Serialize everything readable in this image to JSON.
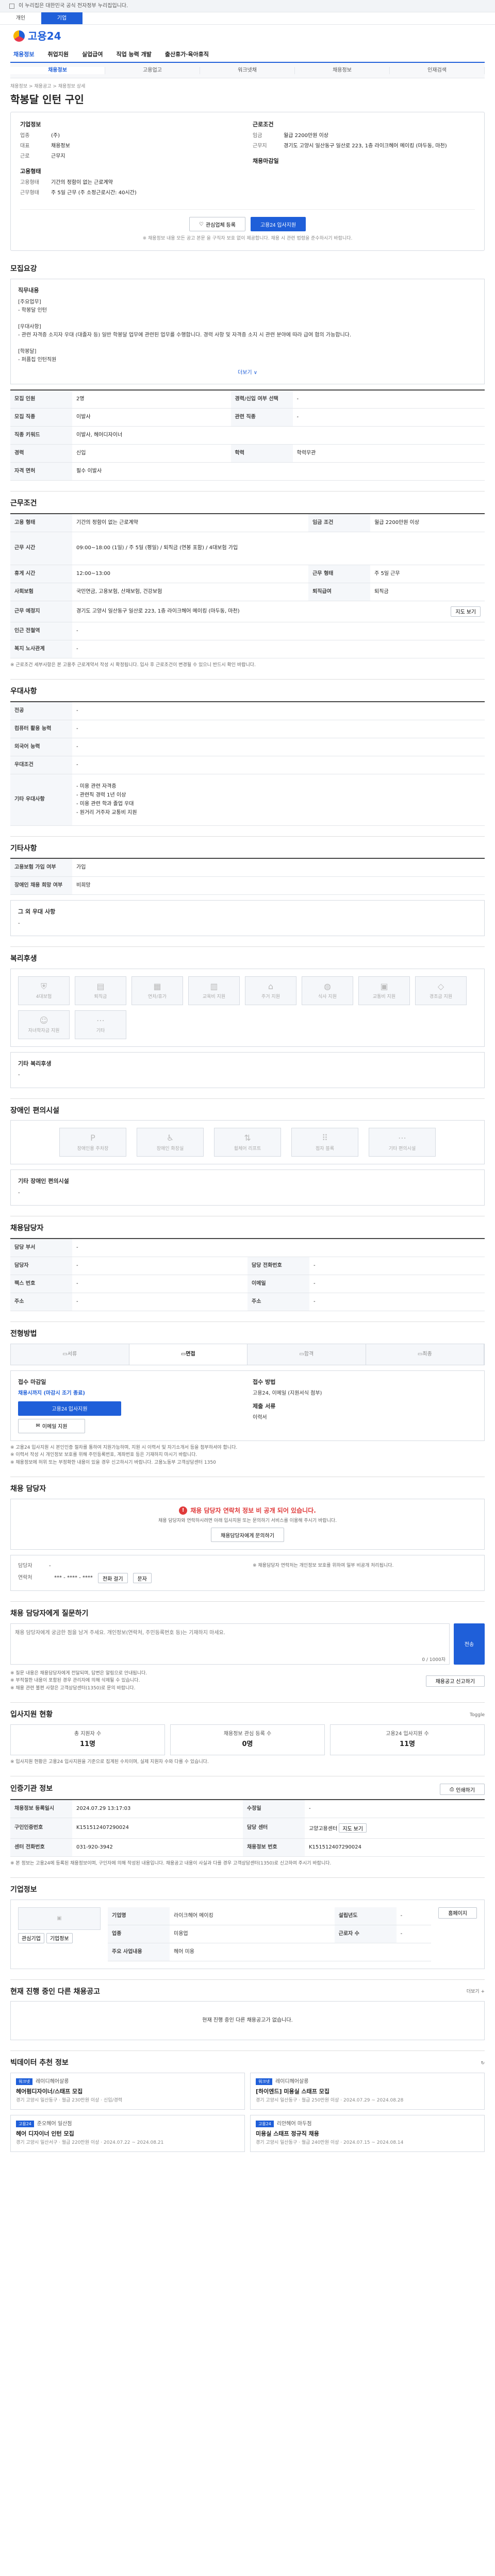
{
  "topbar": {
    "notice": "이 누리집은 대한민국 공식 전자정부 누리집입니다."
  },
  "site_switch": [
    {
      "label": "개인",
      "on": false
    },
    {
      "label": "기업",
      "on": true
    }
  ],
  "logo": {
    "text": "고용24"
  },
  "gnb": [
    {
      "label": "채용정보",
      "on": true
    },
    {
      "label": "취업지원"
    },
    {
      "label": "실업급여"
    },
    {
      "label": "직업 능력 개발"
    },
    {
      "label": "출산휴가·육아휴직"
    }
  ],
  "subnav": [
    "채용정보",
    "고용업고",
    "워크넷채",
    "채용정보",
    "인재검색"
  ],
  "breadcrumb": "채용정보 > 채용공고 > 채용정보 상세",
  "job": {
    "title": "학봉달 인턴 구인",
    "company_section": "기업정보",
    "company_rows": [
      {
        "k": "업종",
        "v": "(주)"
      },
      {
        "k": "대표",
        "v": "채용정보"
      },
      {
        "k": "근로",
        "v": "근무지"
      }
    ],
    "cond_section": "근로조건",
    "cond_rows": [
      {
        "k": "임금",
        "v": "월급 2200만원 이상"
      },
      {
        "k": "근무지",
        "v": "경기도 고양시 일산동구 일산로 223, 1층 라이크헤어 메이킹 (마두동, 마천)"
      }
    ],
    "manager_section": "고용형태",
    "manager_rows": [
      {
        "k": "고용형태",
        "v": "기간의 정함이 없는 근로계약"
      },
      {
        "k": "근무형태",
        "v": "주 5일 근무 (주 소정근로시간: 40시간)"
      }
    ],
    "reception_section": "채용마감일",
    "save_label": "관심업체 등록",
    "apply_label": "고용24 입사지원",
    "note": "※ 채용정보 내용 모든 공고 본문 을 구직자 보호 없이 제공합니다. 채용 시 관련 법령을 준수하시기 바랍니다."
  },
  "recruit": {
    "title": "모집요강",
    "heading": "직무내용",
    "body": "[주요업무]\n- 학봉달 인턴\n\n[우대사항]\n- 관련 자격증 소지자 우대 (대졸자 등) 일반 학봉달 업무에 관련된 업무를 수행합니다. 경력 사항 및 자격증 소지 시 관련 분야에 따라 급여 협의 가능합니다.\n\n[학봉달]\n- 퍼퓸집 인턴직원",
    "more_label": "더보기 ∨",
    "rows": [
      {
        "k": "모집 인원",
        "v": "2명",
        "k2": "경력/신입 여부 선택",
        "v2": "-"
      },
      {
        "k": "모집 직종",
        "v": "이발사",
        "k2": "관련 직종",
        "v2": "-"
      },
      {
        "k": "직종 키워드",
        "v": "이발사, 헤어디자이너",
        "k2": "",
        "v2": ""
      },
      {
        "k": "경력",
        "v": "신입",
        "k2": "학력",
        "v2": "학력무관"
      },
      {
        "k": "자격 면허",
        "v": "필수 이발사",
        "k2": "",
        "v2": ""
      }
    ]
  },
  "work": {
    "title": "근무조건",
    "rows": [
      {
        "k": "고용 형태",
        "v": "기간의 정함이 없는 근로계약",
        "k2": "임금 조건",
        "v2": "월급 2200만원 이상"
      },
      {
        "k": "근무 시간",
        "v": "09:00~18:00 (1일) / 주 5일 (평일) / 퇴직금 (연봉 포함) / 4대보험 가입"
      },
      {
        "k": "휴게 시간",
        "v": "12:00~13:00",
        "k2": "근무 형태",
        "v2": "주 5일 근무"
      },
      {
        "k": "사회보험",
        "v": "국민연금, 고용보험, 산재보험, 건강보험",
        "k2": "퇴직급여",
        "v2": "퇴직금"
      },
      {
        "k": "근무 예정지",
        "v": "경기도 고양시 일산동구 일산로 223, 1층 라이크헤어 메이킹 (마두동, 마천)",
        "k2": "",
        "v2": ""
      },
      {
        "k": "인근 전철역",
        "v": "-",
        "k2": "",
        "v2": ""
      },
      {
        "k": "복지 노사관계",
        "v": "-",
        "k2": "",
        "v2": ""
      }
    ],
    "map_label": "지도 보기",
    "note": "※ 근로조건 세부사항은 본 고용주 근로계약서 작성 시 확정됩니다. 입사 후 근로조건이 변경될 수 있으니 반드시 확인 바랍니다."
  },
  "prefer": {
    "title": "우대사항",
    "rows": [
      {
        "k": "전공",
        "v": "-"
      },
      {
        "k": "컴퓨터 활용 능력",
        "v": "-"
      },
      {
        "k": "외국어 능력",
        "v": "-"
      },
      {
        "k": "우대조건",
        "v": "-"
      },
      {
        "k": "기타 우대사항",
        "v": "- 미용 관련 자격증\n- 관련직 경력 1년 이상\n- 미용 관련 학과 졸업 우대\n- 원거리 거주자 교통비 지원"
      }
    ]
  },
  "extra": {
    "title": "기타사항",
    "rows": [
      {
        "k": "고용보험 가입 여부",
        "v": "가입"
      },
      {
        "k": "장애인 채용 희망 여부",
        "v": "비희망"
      }
    ],
    "more_title": "그 외 우대 사항",
    "more_v": "-"
  },
  "welfare": {
    "title": "복리후생",
    "items": [
      "4대보험",
      "퇴직금",
      "연차/휴가",
      "교육비 지원",
      "주거 지원",
      "식사 지원",
      "교통비 지원",
      "경조금 지원",
      "자녀학자금 지원",
      "기타"
    ],
    "other_title": "기타 복리후생",
    "other_v": "-"
  },
  "disability": {
    "title": "장애인 편의시설",
    "items": [
      "장애인용 주차장",
      "장애인 화장실",
      "휠체어 리프트",
      "점자 블록",
      "기타 편의시설"
    ],
    "other_title": "기타 장애인 편의시설",
    "other_v": "-"
  },
  "manager": {
    "title": "채용담당자",
    "rows": [
      {
        "k": "담당 부서",
        "v": "-",
        "k2": "",
        "v2": ""
      },
      {
        "k": "담당자",
        "v": "-",
        "k2": "담당 전화번호",
        "v2": "-"
      },
      {
        "k": "팩스 번호",
        "v": "-",
        "k2": "이메일",
        "v2": "-"
      },
      {
        "k": "주소",
        "v": "-",
        "k2": "주소",
        "v2": "-"
      }
    ]
  },
  "apply": {
    "title": "전형방법",
    "steps": [
      "서류",
      "면접",
      "합격",
      "최종"
    ],
    "left_title": "접수 마감일",
    "deadline": "채용시까지 (마감시 조기 종료)",
    "apply_button": "고용24 입사지원",
    "fax_button": "이메일 지원",
    "right_title": "접수 방법",
    "method": "고용24, 이메일 (지원서식 첨부)",
    "docs_title": "제출 서류",
    "docs": "이력서",
    "notes": [
      "※ 고용24 입사지원 시 본인인증 절차를 통하여 지원가능하며, 지원 시 이력서 및 자기소개서 등을 첨부하셔야 합니다.",
      "※ 이력서 작성 시 개인정보 보호를 위해 주민등록번호, 계좌번호 등은 기재하지 마시기 바랍니다.",
      "※ 채용정보에 허위 또는 부정확한 내용이 있을 경우 신고하시기 바랍니다. 고용노동부 고객상담센터 1350"
    ]
  },
  "qa": {
    "title": "채용 담당자",
    "alert": "채용 담당자 연락처 정보 비 공개 되어 있습니다.",
    "alert_sub": "채용 담당자와 연락하시려면 아래 입사지원 또는 문의하기 서비스를 이용해 주시기 바랍니다.",
    "contact_btn": "채용담당자에게 문의하기",
    "rows": [
      {
        "k": "담당자",
        "v": "-"
      },
      {
        "k": "연락처",
        "v": "*** - **** - ****"
      }
    ],
    "call_btn": "전화 걸기",
    "sms_btn": "문자",
    "right_note": "※ 채용담당자 연락처는 개인정보 보호를 위하여 일부 비공개 처리됩니다."
  },
  "inquiry": {
    "title": "채용 담당자에게 질문하기",
    "placeholder": "채용 담당자에게 궁금한 점을 남겨 주세요. 개인정보(연락처, 주민등록번호 등)는 기재하지 마세요.",
    "counter": "0 / 1000자",
    "send_label": "전송",
    "notes": [
      "※ 질문 내용은 채용담당자에게 전달되며, 답변은 알림으로 안내됩니다.",
      "※ 부적절한 내용이 포함된 경우 관리자에 의해 삭제될 수 있습니다.",
      "※ 채용 관련 불편 사항은 고객상담센터(1350)로 문의 바랍니다."
    ],
    "report_btn": "채용공고 신고하기"
  },
  "stats": {
    "title": "입사지원 현황",
    "refresh": "Toggle",
    "items": [
      {
        "label": "총 지원자 수",
        "value": "11명"
      },
      {
        "label": "채용정보 관심 등록 수",
        "value": "0명"
      },
      {
        "label": "고용24 입사지원 수",
        "value": "11명"
      }
    ],
    "note": "※ 입사지원 현황은 고용24 입사지원을 기준으로 집계된 수치이며, 실제 지원자 수와 다를 수 있습니다."
  },
  "info": {
    "title": "인증기관 정보",
    "print_btn": "인쇄하기",
    "rows": [
      {
        "k": "채용정보 등록일시",
        "v": "2024.07.29 13:17:03",
        "k2": "수정일",
        "v2": "-"
      },
      {
        "k": "구인인증번호",
        "v": "K151512407290024",
        "k2": "담당 센터",
        "v2": "고양고용센터"
      },
      {
        "k": "센터 전화번호",
        "v": "031-920-3942",
        "k2": "채용정보 번호",
        "v2": "K151512407290024"
      }
    ],
    "center_btn": "지도 보기",
    "note": "※ 본 정보는 고용24에 등록된 채용정보이며, 구인자에 의해 작성된 내용입니다. 채용공고 내용이 사실과 다를 경우 고객상담센터(1350)로 신고하여 주시기 바랍니다."
  },
  "company": {
    "title": "기업정보",
    "rows": [
      {
        "k": "기업명",
        "v": "라이크헤어 메이킹",
        "k2": "설립년도",
        "v2": "-"
      },
      {
        "k": "업종",
        "v": "미용업",
        "k2": "근로자 수",
        "v2": "-"
      },
      {
        "k": "주요 사업내용",
        "v": "헤어 미용",
        "k2": "",
        "v2": ""
      }
    ],
    "homepage_btn": "홈페이지",
    "btn1": "관심기업",
    "btn2": "기업정보"
  },
  "others": {
    "title": "현재 진행 중인 다른 채용공고",
    "more": "더보기 +",
    "empty": "현재 진행 중인 다른 채용공고가 없습니다."
  },
  "recommend": {
    "title": "빅데이터 추천 정보",
    "refresh": "↻",
    "items": [
      {
        "tag": "워크넷",
        "company": "레이디헤어살롱",
        "title": "헤어펌디자이너/스태프 모집",
        "meta": "경기 고양시 일산동구 · 월급 230만원 이상 · 신입/경력"
      },
      {
        "tag": "워크넷",
        "company": "레이디헤어살롱",
        "title": "[하이엔드] 미용실 스태프 모집",
        "meta": "경기 고양시 일산동구 · 월급 250만원 이상 · 2024.07.29 ~ 2024.08.28"
      },
      {
        "tag": "고용24",
        "company": "준오헤어 일산점",
        "title": "헤어 디자이너 인턴 모집",
        "meta": "경기 고양시 일산서구 · 월급 220만원 이상 · 2024.07.22 ~ 2024.08.21"
      },
      {
        "tag": "고용24",
        "company": "리안헤어 마두점",
        "title": "미용실 스태프 정규직 채용",
        "meta": "경기 고양시 일산동구 · 월급 240만원 이상 · 2024.07.15 ~ 2024.08.14"
      }
    ]
  }
}
